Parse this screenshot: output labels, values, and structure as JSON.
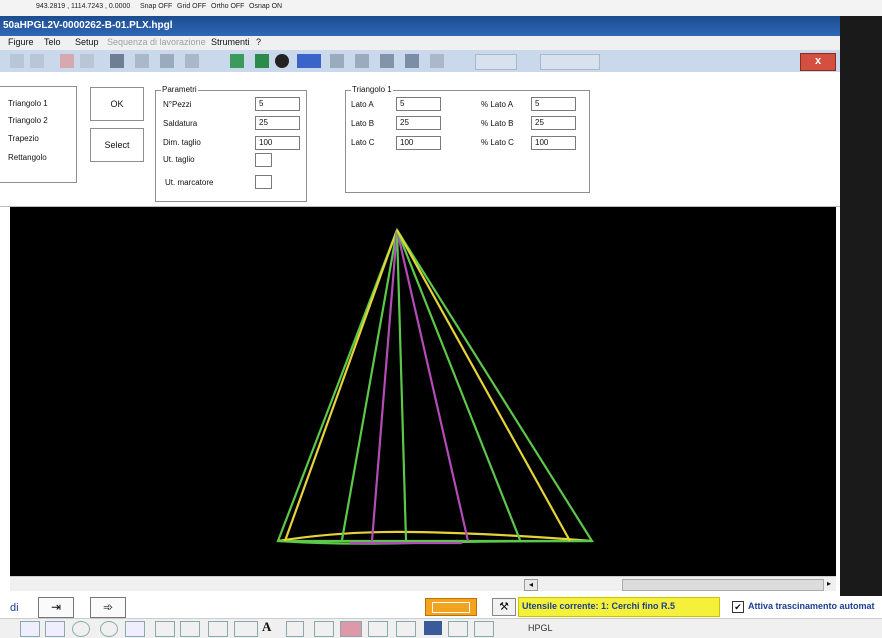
{
  "top_strip": {
    "coords": "943.2819 , 1114.7243 , 0.0000",
    "snap": "Snap OFF",
    "grid": "Grid OFF",
    "ortho": "Ortho OFF",
    "osnap": "Osnap ON"
  },
  "window": {
    "title": "50aHPGL2V-0000262-B-01.PLX.hpgl",
    "close_glyph": "x"
  },
  "menu": [
    "Figure",
    "Telo",
    "Setup",
    "Sequenza di lavorazione",
    "Strumenti",
    "?"
  ],
  "figure_list": [
    "Triangolo 1",
    "Triangolo 2",
    "Trapezio",
    "Rettangolo"
  ],
  "buttons": {
    "ok": "OK",
    "select": "Select"
  },
  "parametri": {
    "legend": "Parametri",
    "npezzi_label": "N°Pezzi",
    "npezzi_value": "5",
    "saldatura_label": "Saldatura",
    "saldatura_value": "25",
    "dim_taglio_label": "Dim. taglio",
    "dim_taglio_value": "100",
    "ut_taglio_label": "Ut. taglio",
    "ut_marcatore_label": "Ut. marcatore"
  },
  "triangolo": {
    "legend": "Triangolo 1",
    "lato_a_label": "Lato A",
    "lato_a_value": "5",
    "lato_b_label": "Lato B",
    "lato_b_value": "25",
    "lato_c_label": "Lato C",
    "lato_c_value": "100",
    "pct_a_label": "% Lato A",
    "pct_a_value": "5",
    "pct_b_label": "% Lato B",
    "pct_b_value": "25",
    "pct_c_label": "% Lato C",
    "pct_c_value": "100"
  },
  "drawing_colors": {
    "background": "#000000",
    "outline": "#5cc84a",
    "yellow": "#e6d33a",
    "magenta": "#b24cb6"
  },
  "status": {
    "left_text": "di",
    "tool_text": "Utensile corrente: 1: Cerchi fino R.5",
    "drag_label": "Attiva trascinamento automat",
    "drag_checked": "✔"
  },
  "bottom_toolbar": {
    "hpgl_label": "HPGL"
  },
  "icons": [
    "export-icon",
    "send-icon",
    "layout-icon",
    "tool-icon",
    "arrow-left-icon",
    "arrow-right-icon"
  ]
}
